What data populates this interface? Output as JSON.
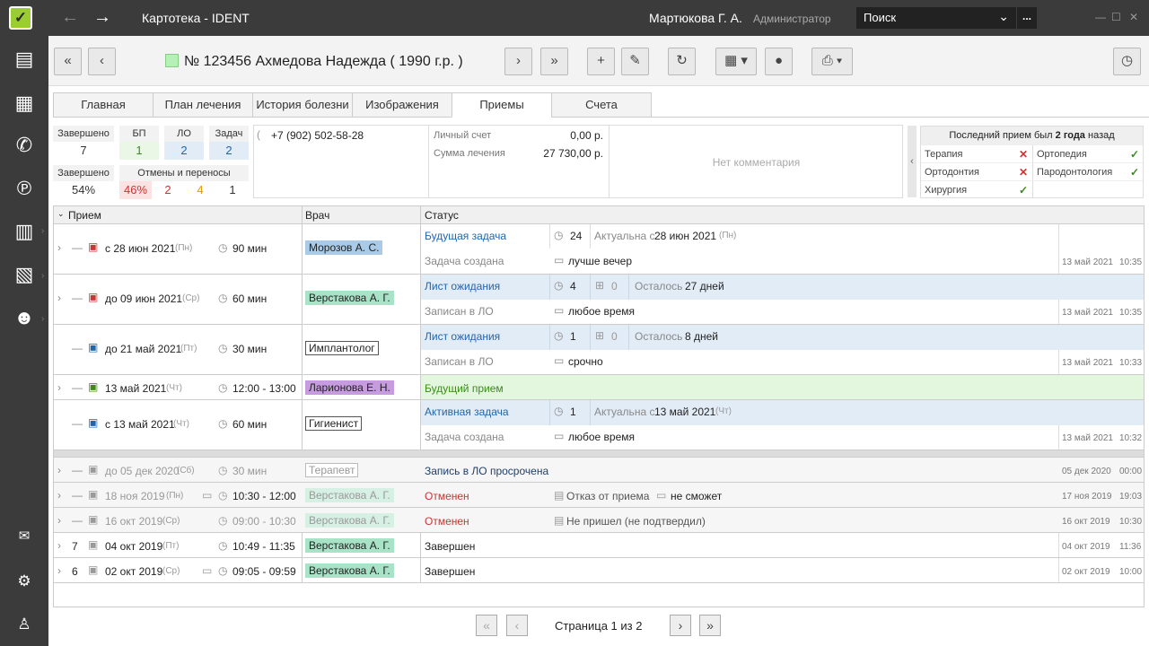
{
  "app": {
    "logo": "✓",
    "title": "Картотека - IDENT",
    "user": "Мартюкова Г. А.",
    "role": "Администратор",
    "search": "Поиск",
    "search_more": "..."
  },
  "toolbar": {
    "patient": "№ 123456 Ахмедова Надежда ( 1990 г.р. )"
  },
  "tabs": [
    "Главная",
    "План лечения",
    "История болезни",
    "Изображения",
    "Приемы",
    "Счета"
  ],
  "stats": {
    "done_label": "Завершено",
    "done_value": "7",
    "bp_label": "БП",
    "bp_value": "1",
    "lo_label": "ЛО",
    "lo_value": "2",
    "tasks_label": "Задач",
    "tasks_value": "2",
    "done_pct_label": "Завершено",
    "done_pct_value": "54%",
    "cancel_label": "Отмены и переносы",
    "cancel_pct": "46%",
    "cancel_a": "2",
    "cancel_b": "4",
    "cancel_c": "1"
  },
  "info": {
    "phone": "+7 (902) 502-58-28",
    "account_label": "Личный счет",
    "account_value": "0,00 р.",
    "treat_label": "Сумма лечения",
    "treat_value": "27 730,00 р.",
    "comment": "Нет комментария"
  },
  "last_visit": {
    "text": "Последний прием был",
    "bold": "2 года",
    "tail": "назад",
    "specs": [
      {
        "name": "Терапия",
        "ok": false
      },
      {
        "name": "Ортопедия",
        "ok": true
      },
      {
        "name": "Ортодонтия",
        "ok": false
      },
      {
        "name": "Пародонтология",
        "ok": true
      },
      {
        "name": "Хирургия",
        "ok": true
      }
    ]
  },
  "grid": {
    "headers": {
      "visit": "Прием",
      "doctor": "Врач",
      "status": "Статус"
    },
    "rows": [
      {
        "num": "—",
        "date": "с 28 июн 2021",
        "dow": "(Пн)",
        "dur": "90 мин",
        "doctor": "Морозов А. С.",
        "status": "Будущая задача",
        "status2": "Задача создана",
        "n": "24",
        "extra": "Актуальна с",
        "extra_b": "28 июн 2021",
        "extra_c": "(Пн)",
        "note": "лучше вечер",
        "d": "13 май 2021",
        "t": "10:35"
      },
      {
        "num": "—",
        "date": "до 09 июн 2021",
        "dow": "(Ср)",
        "dur": "60 мин",
        "doctor": "Верстакова А. Г.",
        "status": "Лист ожидания",
        "status2": "Записан в ЛО",
        "n": "4",
        "z": "0",
        "extra": "Осталось",
        "extra_b": "27 дней",
        "note": "любое время",
        "d": "13 май 2021",
        "t": "10:35"
      },
      {
        "num": "—",
        "date": "до 21 май 2021",
        "dow": "(Пт)",
        "dur": "30 мин",
        "doctor": "Имплантолог",
        "status": "Лист ожидания",
        "status2": "Записан в ЛО",
        "n": "1",
        "z": "0",
        "extra": "Осталось",
        "extra_b": "8 дней",
        "note": "срочно",
        "d": "13 май 2021",
        "t": "10:33"
      },
      {
        "num": "—",
        "date": "13 май 2021",
        "dow": "(Чт)",
        "dur": "12:00 - 13:00",
        "doctor": "Ларионова Е. Н.",
        "status": "Будущий прием"
      },
      {
        "num": "—",
        "date": "с 13 май 2021",
        "dow": "(Чт)",
        "dur": "60 мин",
        "doctor": "Гигиенист",
        "status": "Активная задача",
        "status2": "Задача создана",
        "n": "1",
        "extra": "Актуальна с",
        "extra_b": "13 май 2021",
        "extra_c": "(Чт)",
        "note": "любое время",
        "d": "13 май 2021",
        "t": "10:32"
      },
      {
        "num": "—",
        "date": "до 05 дек 2020",
        "dow": "(Сб)",
        "dur": "30 мин",
        "doctor": "Терапевт",
        "status": "Запись в ЛО просрочена",
        "d": "05 дек 2020",
        "t": "00:00"
      },
      {
        "num": "—",
        "date": "18 ноя 2019",
        "dow": "(Пн)",
        "dur": "10:30 - 12:00",
        "doctor": "Верстакова А. Г.",
        "status": "Отменен",
        "reason": "Отказ от приема",
        "note": "не сможет",
        "d": "17 ноя 2019",
        "t": "19:03"
      },
      {
        "num": "—",
        "date": "16 окт 2019",
        "dow": "(Ср)",
        "dur": "09:00 - 10:30",
        "doctor": "Верстакова А. Г.",
        "status": "Отменен",
        "reason": "Не пришел (не подтвердил)",
        "d": "16 окт 2019",
        "t": "10:30"
      },
      {
        "num": "7",
        "date": "04 окт 2019",
        "dow": "(Пт)",
        "dur": "10:49 - 11:35",
        "doctor": "Верстакова А. Г.",
        "status": "Завершен",
        "d": "04 окт 2019",
        "t": "11:36"
      },
      {
        "num": "6",
        "date": "02 окт 2019",
        "dow": "(Ср)",
        "dur": "09:05 - 09:59",
        "doctor": "Верстакова А. Г.",
        "status": "Завершен",
        "d": "02 окт 2019",
        "t": "10:00"
      }
    ]
  },
  "pager": {
    "label": "Страница",
    "page": "1",
    "of": "из 2"
  },
  "colors": {
    "accent": "#9acd32",
    "dark": "#3b3b3b",
    "blue_band": "#e2ecf7",
    "green_band": "#e3f6de",
    "doc_blue": "#a9cbe8",
    "doc_green": "#a8e3c8",
    "doc_purple": "#c79be0"
  }
}
